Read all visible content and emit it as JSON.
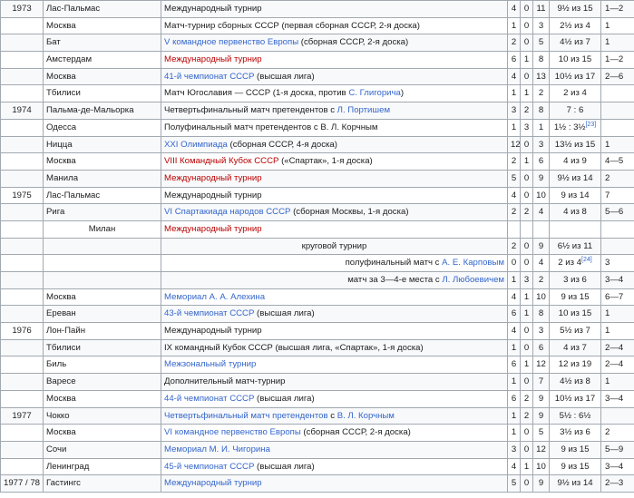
{
  "rows": [
    {
      "year": "1973",
      "city": "Лас-Пальмас",
      "event": [
        {
          "t": "Международный турнир"
        }
      ],
      "w": "4",
      "l": "0",
      "d": "11",
      "res": "9½ из 15",
      "place": "1—2"
    },
    {
      "year": "",
      "city": "Москва",
      "event": [
        {
          "t": "Матч-турнир сборных СССР (первая сборная СССР, 2-я доска)"
        }
      ],
      "w": "1",
      "l": "0",
      "d": "3",
      "res": "2½ из 4",
      "place": "1"
    },
    {
      "year": "",
      "city": "Бат",
      "event": [
        {
          "t": "V командное первенство Европы",
          "c": "blue"
        },
        {
          "t": " (сборная СССР, 2-я доска)"
        }
      ],
      "w": "2",
      "l": "0",
      "d": "5",
      "res": "4½ из 7",
      "place": "1"
    },
    {
      "year": "",
      "city": "Амстердам",
      "event": [
        {
          "t": "Международный турнир",
          "c": "red"
        }
      ],
      "w": "6",
      "l": "1",
      "d": "8",
      "res": "10 из 15",
      "place": "1—2"
    },
    {
      "year": "",
      "city": "Москва",
      "event": [
        {
          "t": "41-й чемпионат СССР",
          "c": "blue"
        },
        {
          "t": " (высшая лига)"
        }
      ],
      "w": "4",
      "l": "0",
      "d": "13",
      "res": "10½ из 17",
      "place": "2—6"
    },
    {
      "year": "",
      "city": "Тбилиси",
      "event": [
        {
          "t": "Матч Югославия — СССР (1-я доска, против "
        },
        {
          "t": "С. Глигорича",
          "c": "blue"
        },
        {
          "t": ")"
        }
      ],
      "w": "1",
      "l": "1",
      "d": "2",
      "res": "2 из 4",
      "place": ""
    },
    {
      "year": "1974",
      "city": "Пальма-де-Мальорка",
      "event": [
        {
          "t": "Четвертьфинальный матч претендентов с "
        },
        {
          "t": "Л. Портишем",
          "c": "blue"
        }
      ],
      "w": "3",
      "l": "2",
      "d": "8",
      "res": "7 : 6",
      "place": ""
    },
    {
      "year": "",
      "city": "Одесса",
      "event": [
        {
          "t": "Полуфинальный матч претендентов с В. Л. Корчным"
        }
      ],
      "w": "1",
      "l": "3",
      "d": "1",
      "res": "1½ : 3½",
      "sup": "[23]",
      "place": ""
    },
    {
      "year": "",
      "city": "Ницца",
      "event": [
        {
          "t": "XXI Олимпиада",
          "c": "blue"
        },
        {
          "t": " (сборная СССР, 4-я доска)"
        }
      ],
      "w": "12",
      "l": "0",
      "d": "3",
      "res": "13½ из 15",
      "place": "1"
    },
    {
      "year": "",
      "city": "Москва",
      "event": [
        {
          "t": "VIII Командный Кубок СССР",
          "c": "red"
        },
        {
          "t": " («Спартак», 1-я доска)"
        }
      ],
      "w": "2",
      "l": "1",
      "d": "6",
      "res": "4 из 9",
      "place": "4—5"
    },
    {
      "year": "",
      "city": "Манила",
      "event": [
        {
          "t": "Международный турнир",
          "c": "red"
        }
      ],
      "w": "5",
      "l": "0",
      "d": "9",
      "res": "9½ из 14",
      "place": "2"
    },
    {
      "year": "1975",
      "city": "Лас-Пальмас",
      "event": [
        {
          "t": "Международный турнир"
        }
      ],
      "w": "4",
      "l": "0",
      "d": "10",
      "res": "9 из 14",
      "place": "7"
    },
    {
      "year": "",
      "city": "Рига",
      "event": [
        {
          "t": "VI Спартакиада народов СССР",
          "c": "blue"
        },
        {
          "t": " (сборная Москвы, 1-я доска)"
        }
      ],
      "w": "2",
      "l": "2",
      "d": "4",
      "res": "4 из 8",
      "place": "5—6"
    },
    {
      "year": "",
      "city": "Милан",
      "city_center": true,
      "event": [
        {
          "t": "Международный турнир",
          "c": "red"
        }
      ],
      "w": "",
      "l": "",
      "d": "",
      "res": "",
      "place": ""
    },
    {
      "year": "",
      "city": "",
      "event": [
        {
          "t": "круговой турнир"
        }
      ],
      "event_center": true,
      "w": "2",
      "l": "0",
      "d": "9",
      "res": "6½ из 11",
      "place": ""
    },
    {
      "year": "",
      "city": "",
      "event": [
        {
          "t": "полуфинальный матч с "
        },
        {
          "t": "А. Е. Карповым",
          "c": "blue"
        }
      ],
      "event_right": true,
      "w": "0",
      "l": "0",
      "d": "4",
      "res": "2 из 4",
      "sup": "[24]",
      "place": "3"
    },
    {
      "year": "",
      "city": "",
      "event": [
        {
          "t": "матч за 3—4-е места с "
        },
        {
          "t": "Л. Любоевичем",
          "c": "blue"
        }
      ],
      "event_right": true,
      "w": "1",
      "l": "3",
      "d": "2",
      "res": "3 из 6",
      "place": "3—4"
    },
    {
      "year": "",
      "city": "Москва",
      "event": [
        {
          "t": "Мемориал А. А. Алехина",
          "c": "blue"
        }
      ],
      "w": "4",
      "l": "1",
      "d": "10",
      "res": "9 из 15",
      "place": "6—7"
    },
    {
      "year": "",
      "city": "Ереван",
      "event": [
        {
          "t": "43-й чемпионат СССР",
          "c": "blue"
        },
        {
          "t": " (высшая лига)"
        }
      ],
      "w": "6",
      "l": "1",
      "d": "8",
      "res": "10 из 15",
      "place": "1"
    },
    {
      "year": "1976",
      "city": "Лон-Пайн",
      "event": [
        {
          "t": "Международный турнир"
        }
      ],
      "w": "4",
      "l": "0",
      "d": "3",
      "res": "5½ из 7",
      "place": "1"
    },
    {
      "year": "",
      "city": "Тбилиси",
      "event": [
        {
          "t": "IX командный Кубок СССР (высшая лига, «Спартак», 1-я доска)"
        }
      ],
      "w": "1",
      "l": "0",
      "d": "6",
      "res": "4 из 7",
      "place": "2—4"
    },
    {
      "year": "",
      "city": "Биль",
      "event": [
        {
          "t": "Межзональный турнир",
          "c": "blue"
        }
      ],
      "w": "6",
      "l": "1",
      "d": "12",
      "res": "12 из 19",
      "place": "2—4"
    },
    {
      "year": "",
      "city": "Варесе",
      "event": [
        {
          "t": "Дополнительный матч-турнир"
        }
      ],
      "w": "1",
      "l": "0",
      "d": "7",
      "res": "4½ из 8",
      "place": "1"
    },
    {
      "year": "",
      "city": "Москва",
      "event": [
        {
          "t": "44-й чемпионат СССР",
          "c": "blue"
        },
        {
          "t": " (высшая лига)"
        }
      ],
      "w": "6",
      "l": "2",
      "d": "9",
      "res": "10½ из 17",
      "place": "3—4"
    },
    {
      "year": "1977",
      "city": "Чокко",
      "event": [
        {
          "t": "Четвертьфинальный матч претендентов",
          "c": "blue"
        },
        {
          "t": " с "
        },
        {
          "t": "В. Л. Корчным",
          "c": "blue"
        }
      ],
      "w": "1",
      "l": "2",
      "d": "9",
      "res": "5½ : 6½",
      "place": ""
    },
    {
      "year": "",
      "city": "Москва",
      "event": [
        {
          "t": "VI командное первенство Европы",
          "c": "blue"
        },
        {
          "t": " (сборная СССР, 2-я доска)"
        }
      ],
      "w": "1",
      "l": "0",
      "d": "5",
      "res": "3½ из 6",
      "place": "2"
    },
    {
      "year": "",
      "city": "Сочи",
      "event": [
        {
          "t": "Мемориал М. И. Чигорина",
          "c": "blue"
        }
      ],
      "w": "3",
      "l": "0",
      "d": "12",
      "res": "9 из 15",
      "place": "5—9"
    },
    {
      "year": "",
      "city": "Ленинград",
      "event": [
        {
          "t": "45-й чемпионат СССР",
          "c": "blue"
        },
        {
          "t": " (высшая лига)"
        }
      ],
      "w": "4",
      "l": "1",
      "d": "10",
      "res": "9 из 15",
      "place": "3—4"
    },
    {
      "year": "1977 / 78",
      "city": "Гастингс",
      "event": [
        {
          "t": "Международный турнир",
          "c": "blue"
        }
      ],
      "w": "5",
      "l": "0",
      "d": "9",
      "res": "9½ из 14",
      "place": "2—3"
    }
  ]
}
